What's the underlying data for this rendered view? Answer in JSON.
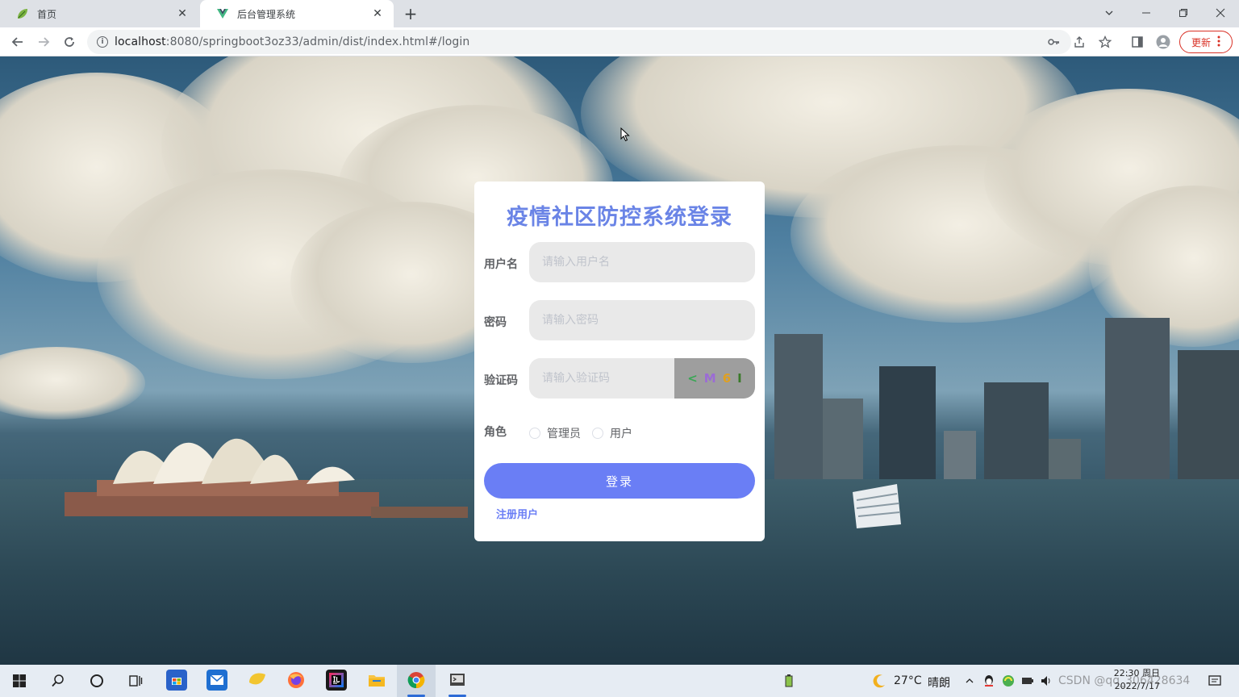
{
  "browser": {
    "tabs": [
      {
        "title": "首页",
        "active": false
      },
      {
        "title": "后台管理系统",
        "active": true
      }
    ],
    "close_glyph": "✕",
    "new_tab_glyph": "+",
    "url_host": "localhost",
    "url_rest": ":8080/springboot3oz33/admin/dist/index.html#/login",
    "update_label": "更新"
  },
  "login": {
    "title": "疫情社区防控系统登录",
    "username_label": "用户名",
    "username_placeholder": "请输入用户名",
    "password_label": "密码",
    "password_placeholder": "请输入密码",
    "captcha_label": "验证码",
    "captcha_placeholder": "请输入验证码",
    "captcha_chars": [
      {
        "char": "<",
        "color": "#3aa655"
      },
      {
        "char": "M",
        "color": "#9b6bd6"
      },
      {
        "char": "6",
        "color": "#e0a020"
      },
      {
        "char": "I",
        "color": "#3a7a2a"
      }
    ],
    "role_label": "角色",
    "roles": [
      "管理员",
      "用户"
    ],
    "submit_label": "登录",
    "register_label": "注册用户"
  },
  "taskbar": {
    "weather_temp": "27°C",
    "weather_desc": "晴朗",
    "time": "22:30 周日",
    "date": "2022/7/17",
    "watermark": "CSDN @qq_306428634"
  },
  "colors": {
    "accent": "#6a7ef5",
    "title": "#6a84e6"
  }
}
